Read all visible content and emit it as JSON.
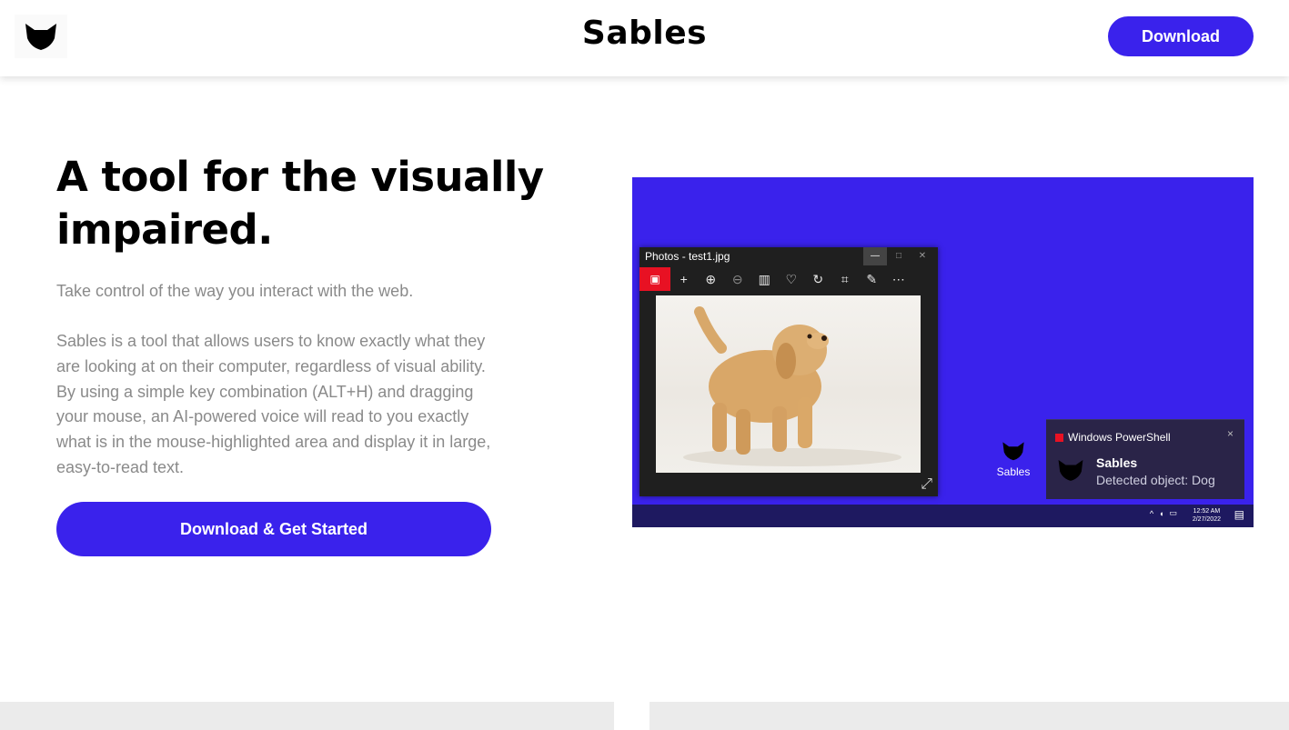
{
  "header": {
    "logo_icon": "fox-mask-icon",
    "title": "Sables",
    "download_label": "Download"
  },
  "hero": {
    "title": "A tool for the visually impaired.",
    "tagline": "Take control of the way you interact with the web.",
    "description": "Sables is a tool that allows users to know exactly what they are looking at on their computer, regardless of visual ability. By using a simple key combination (ALT+H) and dragging your mouse, an AI-powered voice will read to you exactly what is in the mouse-highlighted area and display it in large, easy-to-read text.",
    "cta_label": "Download & Get Started"
  },
  "screenshot": {
    "photos_window": {
      "title": "Photos - test1.jpg",
      "image": "golden-retriever-puppy-in-snow"
    },
    "desktop_icon_label": "Sables",
    "toast": {
      "app": "Windows PowerShell",
      "close": "×",
      "heading": "Sables",
      "body": "Detected object: Dog"
    },
    "taskbar": {
      "time": "12:52 AM",
      "date": "2/27/2022"
    }
  },
  "colors": {
    "accent": "#3a22ec",
    "text_muted": "#8a8a8a",
    "footer_card": "#ebebeb"
  }
}
